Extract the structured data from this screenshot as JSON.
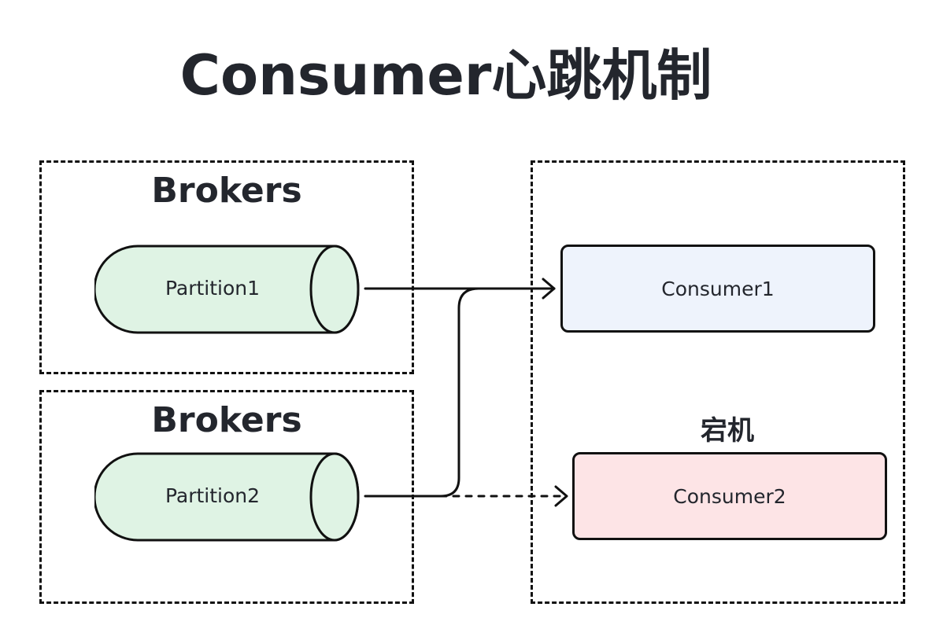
{
  "title": "Consumer心跳机制",
  "broker_groups": [
    {
      "title": "Brokers",
      "partition": "Partition1"
    },
    {
      "title": "Brokers",
      "partition": "Partition2"
    }
  ],
  "consumers": [
    {
      "label": "Consumer1",
      "fill": "#eef3fc"
    },
    {
      "label": "Consumer2",
      "fill": "#fde4e6",
      "status": "宕机"
    }
  ],
  "colors": {
    "partition_fill": "#dff3e4",
    "stroke": "#111111",
    "text": "#23262d"
  }
}
